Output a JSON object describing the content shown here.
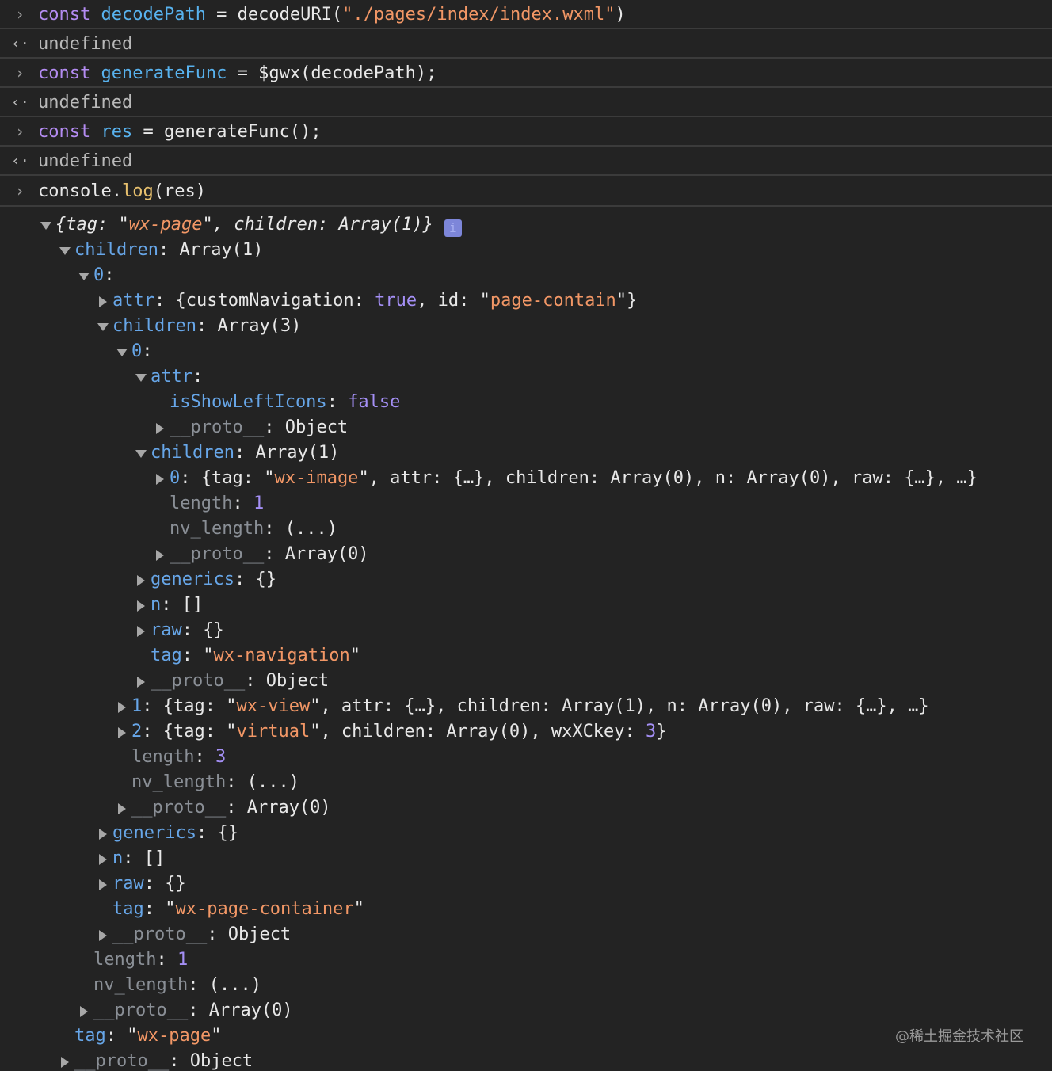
{
  "commands": [
    {
      "input": [
        [
          "kw",
          "const "
        ],
        [
          "var",
          "decodePath"
        ],
        [
          "pun",
          " = decodeURI("
        ],
        [
          "str",
          "\"./pages/index/index.wxml\""
        ],
        [
          "pun",
          ")"
        ]
      ],
      "result": "undefined"
    },
    {
      "input": [
        [
          "kw",
          "const "
        ],
        [
          "var",
          "generateFunc"
        ],
        [
          "pun",
          " = $gwx(decodePath);"
        ]
      ],
      "result": "undefined"
    },
    {
      "input": [
        [
          "kw",
          "const "
        ],
        [
          "var",
          "res"
        ],
        [
          "pun",
          " = generateFunc();"
        ]
      ],
      "result": "undefined"
    },
    {
      "input": [
        [
          "pun",
          "console."
        ],
        [
          "fn",
          "log"
        ],
        [
          "pun",
          "(res)"
        ]
      ],
      "result": null
    }
  ],
  "tree": [
    {
      "indent": 0,
      "toggle": "open",
      "italic": true,
      "badge": "i",
      "parts": [
        [
          "pun",
          "{tag: "
        ],
        [
          "strquote",
          "\""
        ],
        [
          "str",
          "wx-page"
        ],
        [
          "strquote",
          "\""
        ],
        [
          "pun",
          ", children: Array(1)}"
        ]
      ]
    },
    {
      "indent": 1,
      "toggle": "open",
      "parts": [
        [
          "key",
          "children"
        ],
        [
          "pun",
          ": Array(1)"
        ]
      ]
    },
    {
      "indent": 2,
      "toggle": "open",
      "parts": [
        [
          "key",
          "0"
        ],
        [
          "pun",
          ":"
        ]
      ]
    },
    {
      "indent": 3,
      "toggle": "closed",
      "parts": [
        [
          "key",
          "attr"
        ],
        [
          "pun",
          ": {customNavigation: "
        ],
        [
          "bool",
          "true"
        ],
        [
          "pun",
          ", id: "
        ],
        [
          "strquote",
          "\""
        ],
        [
          "str",
          "page-contain"
        ],
        [
          "strquote",
          "\""
        ],
        [
          "pun",
          "}"
        ]
      ]
    },
    {
      "indent": 3,
      "toggle": "open",
      "parts": [
        [
          "key",
          "children"
        ],
        [
          "pun",
          ": Array(3)"
        ]
      ]
    },
    {
      "indent": 4,
      "toggle": "open",
      "parts": [
        [
          "key",
          "0"
        ],
        [
          "pun",
          ":"
        ]
      ]
    },
    {
      "indent": 5,
      "toggle": "open",
      "parts": [
        [
          "key",
          "attr"
        ],
        [
          "pun",
          ":"
        ]
      ]
    },
    {
      "indent": 6,
      "toggle": "none",
      "parts": [
        [
          "key",
          "isShowLeftIcons"
        ],
        [
          "pun",
          ": "
        ],
        [
          "bool",
          "false"
        ]
      ]
    },
    {
      "indent": 6,
      "toggle": "closed",
      "parts": [
        [
          "dim",
          "__proto__"
        ],
        [
          "pun",
          ": Object"
        ]
      ]
    },
    {
      "indent": 5,
      "toggle": "open",
      "parts": [
        [
          "key",
          "children"
        ],
        [
          "pun",
          ": Array(1)"
        ]
      ]
    },
    {
      "indent": 6,
      "toggle": "closed",
      "parts": [
        [
          "key",
          "0"
        ],
        [
          "pun",
          ": {tag: "
        ],
        [
          "strquote",
          "\""
        ],
        [
          "str",
          "wx-image"
        ],
        [
          "strquote",
          "\""
        ],
        [
          "pun",
          ", attr: {…}, children: Array(0), n: Array(0), raw: {…}, …}"
        ]
      ]
    },
    {
      "indent": 6,
      "toggle": "none",
      "parts": [
        [
          "dim",
          "length"
        ],
        [
          "pun",
          ": "
        ],
        [
          "num",
          "1"
        ]
      ]
    },
    {
      "indent": 6,
      "toggle": "none",
      "parts": [
        [
          "dim",
          "nv_length"
        ],
        [
          "pun",
          ": (...)"
        ]
      ]
    },
    {
      "indent": 6,
      "toggle": "closed",
      "parts": [
        [
          "dim",
          "__proto__"
        ],
        [
          "pun",
          ": Array(0)"
        ]
      ]
    },
    {
      "indent": 5,
      "toggle": "closed",
      "parts": [
        [
          "key",
          "generics"
        ],
        [
          "pun",
          ": {}"
        ]
      ]
    },
    {
      "indent": 5,
      "toggle": "closed",
      "parts": [
        [
          "key",
          "n"
        ],
        [
          "pun",
          ": []"
        ]
      ]
    },
    {
      "indent": 5,
      "toggle": "closed",
      "parts": [
        [
          "key",
          "raw"
        ],
        [
          "pun",
          ": {}"
        ]
      ]
    },
    {
      "indent": 5,
      "toggle": "none",
      "parts": [
        [
          "key",
          "tag"
        ],
        [
          "pun",
          ": "
        ],
        [
          "strquote",
          "\""
        ],
        [
          "str",
          "wx-navigation"
        ],
        [
          "strquote",
          "\""
        ]
      ]
    },
    {
      "indent": 5,
      "toggle": "closed",
      "parts": [
        [
          "dim",
          "__proto__"
        ],
        [
          "pun",
          ": Object"
        ]
      ]
    },
    {
      "indent": 4,
      "toggle": "closed",
      "parts": [
        [
          "key",
          "1"
        ],
        [
          "pun",
          ": {tag: "
        ],
        [
          "strquote",
          "\""
        ],
        [
          "str",
          "wx-view"
        ],
        [
          "strquote",
          "\""
        ],
        [
          "pun",
          ", attr: {…}, children: Array(1), n: Array(0), raw: {…}, …}"
        ]
      ]
    },
    {
      "indent": 4,
      "toggle": "closed",
      "parts": [
        [
          "key",
          "2"
        ],
        [
          "pun",
          ": {tag: "
        ],
        [
          "strquote",
          "\""
        ],
        [
          "str",
          "virtual"
        ],
        [
          "strquote",
          "\""
        ],
        [
          "pun",
          ", children: Array(0), wxXCkey: "
        ],
        [
          "num",
          "3"
        ],
        [
          "pun",
          "}"
        ]
      ]
    },
    {
      "indent": 4,
      "toggle": "none",
      "parts": [
        [
          "dim",
          "length"
        ],
        [
          "pun",
          ": "
        ],
        [
          "num",
          "3"
        ]
      ]
    },
    {
      "indent": 4,
      "toggle": "none",
      "parts": [
        [
          "dim",
          "nv_length"
        ],
        [
          "pun",
          ": (...)"
        ]
      ]
    },
    {
      "indent": 4,
      "toggle": "closed",
      "parts": [
        [
          "dim",
          "__proto__"
        ],
        [
          "pun",
          ": Array(0)"
        ]
      ]
    },
    {
      "indent": 3,
      "toggle": "closed",
      "parts": [
        [
          "key",
          "generics"
        ],
        [
          "pun",
          ": {}"
        ]
      ]
    },
    {
      "indent": 3,
      "toggle": "closed",
      "parts": [
        [
          "key",
          "n"
        ],
        [
          "pun",
          ": []"
        ]
      ]
    },
    {
      "indent": 3,
      "toggle": "closed",
      "parts": [
        [
          "key",
          "raw"
        ],
        [
          "pun",
          ": {}"
        ]
      ]
    },
    {
      "indent": 3,
      "toggle": "none",
      "parts": [
        [
          "key",
          "tag"
        ],
        [
          "pun",
          ": "
        ],
        [
          "strquote",
          "\""
        ],
        [
          "str",
          "wx-page-container"
        ],
        [
          "strquote",
          "\""
        ]
      ]
    },
    {
      "indent": 3,
      "toggle": "closed",
      "parts": [
        [
          "dim",
          "__proto__"
        ],
        [
          "pun",
          ": Object"
        ]
      ]
    },
    {
      "indent": 2,
      "toggle": "none",
      "parts": [
        [
          "dim",
          "length"
        ],
        [
          "pun",
          ": "
        ],
        [
          "num",
          "1"
        ]
      ]
    },
    {
      "indent": 2,
      "toggle": "none",
      "parts": [
        [
          "dim",
          "nv_length"
        ],
        [
          "pun",
          ": (...)"
        ]
      ]
    },
    {
      "indent": 2,
      "toggle": "closed",
      "parts": [
        [
          "dim",
          "__proto__"
        ],
        [
          "pun",
          ": Array(0)"
        ]
      ]
    },
    {
      "indent": 1,
      "toggle": "none",
      "parts": [
        [
          "key",
          "tag"
        ],
        [
          "pun",
          ": "
        ],
        [
          "strquote",
          "\""
        ],
        [
          "str",
          "wx-page"
        ],
        [
          "strquote",
          "\""
        ]
      ]
    },
    {
      "indent": 1,
      "toggle": "closed",
      "parts": [
        [
          "dim",
          "__proto__"
        ],
        [
          "pun",
          ": Object"
        ]
      ]
    }
  ],
  "watermark": "@稀土掘金技术社区",
  "colors": {
    "background": "#232323",
    "keyword": "#b48cf2",
    "string": "#f29766",
    "property": "#67a6e8",
    "number": "#a48ff5"
  },
  "icons": {
    "prompt": "chevron-right-icon",
    "result": "return-arrow-icon",
    "badge": "info-icon"
  }
}
